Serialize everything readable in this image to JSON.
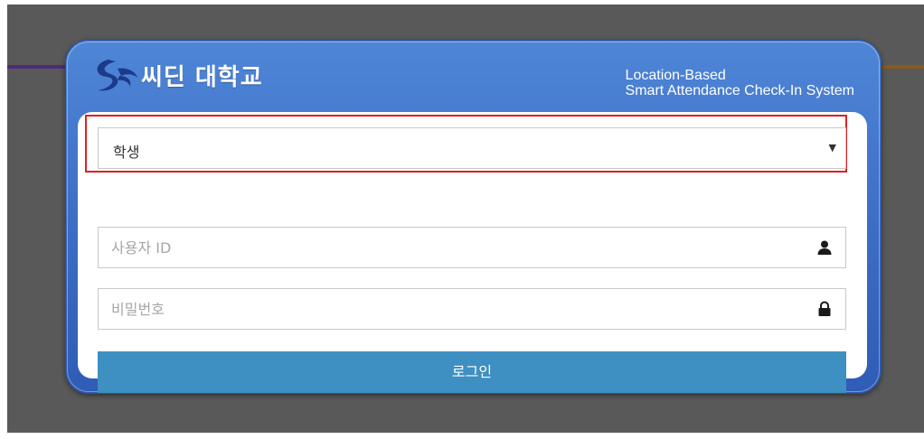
{
  "brand": {
    "logo_icon": "seedin-swoosh-logo",
    "name": "씨딘 대학교"
  },
  "system_title": {
    "line1": "Location-Based",
    "line2": "Smart Attendance Check-In System"
  },
  "form": {
    "role_select": {
      "selected": "학생",
      "arrow": "▼"
    },
    "user_id": {
      "placeholder": "사용자 ID",
      "value": "",
      "icon": "user-icon"
    },
    "password": {
      "placeholder": "비밀번호",
      "value": "",
      "icon": "lock-icon"
    },
    "login_label": "로그인"
  },
  "colors": {
    "backdrop": "#595959",
    "dialog": "#3c6cc4",
    "highlight_border": "#e02020",
    "login_button": "#3e8fc2"
  }
}
